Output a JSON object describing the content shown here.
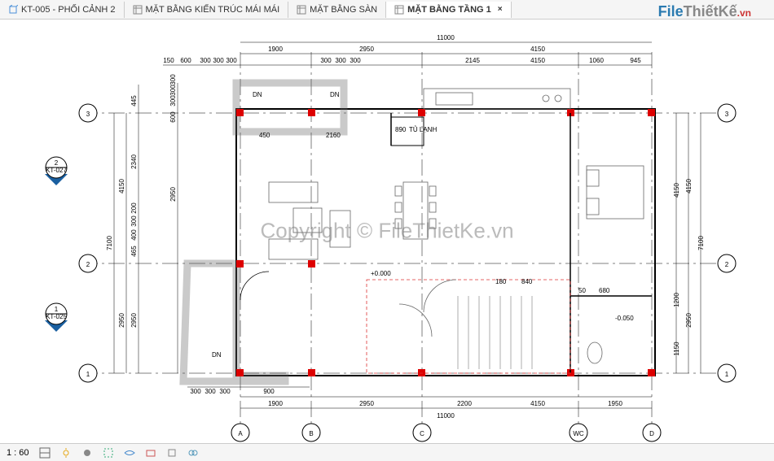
{
  "tabs": [
    {
      "label": "KT-005 - PHỐI CẢNH 2",
      "icon": "3d-view-icon",
      "active": false
    },
    {
      "label": "MẶT BẰNG KIẾN TRÚC MÁI MÁI",
      "icon": "plan-icon",
      "active": false
    },
    {
      "label": "MẶT BẰNG SÀN",
      "icon": "plan-icon",
      "active": false
    },
    {
      "label": "MẶT BẰNG TẦNG 1",
      "icon": "plan-icon",
      "active": true
    }
  ],
  "logo": {
    "part1": "F",
    "part2": "ile",
    "part3": "ThiếtKế",
    "part4": ".vn"
  },
  "copyright": "Copyright © FileThietKe.vn",
  "status": {
    "scale": "1 : 60"
  },
  "drawing": {
    "dims_top": {
      "overall": "11000",
      "row1": [
        "1900",
        "2950",
        "4150"
      ],
      "row2_left": [
        "150",
        "600",
        "300",
        "300",
        "300"
      ],
      "row2_right": [
        "300",
        "300",
        "300",
        "2145",
        "4150",
        "1060",
        "945"
      ]
    },
    "dims_bottom": {
      "overall": "11000",
      "row1": [
        "1900",
        "2950",
        "2200",
        "4150",
        "1950"
      ],
      "row2": [
        "300",
        "300",
        "300",
        "900"
      ]
    },
    "dims_left": {
      "overall": "7100",
      "row1": [
        "2950",
        "4150"
      ],
      "row2": [
        "2950",
        "465",
        "400",
        "300",
        "200",
        "2340",
        "445"
      ],
      "row3_inside": [
        "2950",
        "600",
        "300",
        "300",
        "300"
      ]
    },
    "dims_right": {
      "overall": "7100",
      "row1": [
        "2950",
        "4150"
      ],
      "row2": [
        "4150",
        "1200",
        "1150"
      ]
    },
    "grid_labels_h": [
      "1",
      "2",
      "3"
    ],
    "grid_labels_v_bottom": [
      "A",
      "B",
      "C",
      "WC",
      "D"
    ],
    "section_markers": [
      {
        "num": "2",
        "sheet": "KT-027"
      },
      {
        "num": "1",
        "sheet": "KT-025"
      }
    ],
    "room_labels": {
      "fridge": "TỦ LẠNH",
      "fridge_dim": "890",
      "level_zero": "+0.000",
      "level_neg": "-0.050",
      "dn": "DN"
    },
    "interior_dims": [
      "450",
      "2160",
      "180",
      "840",
      "50",
      "680"
    ]
  }
}
